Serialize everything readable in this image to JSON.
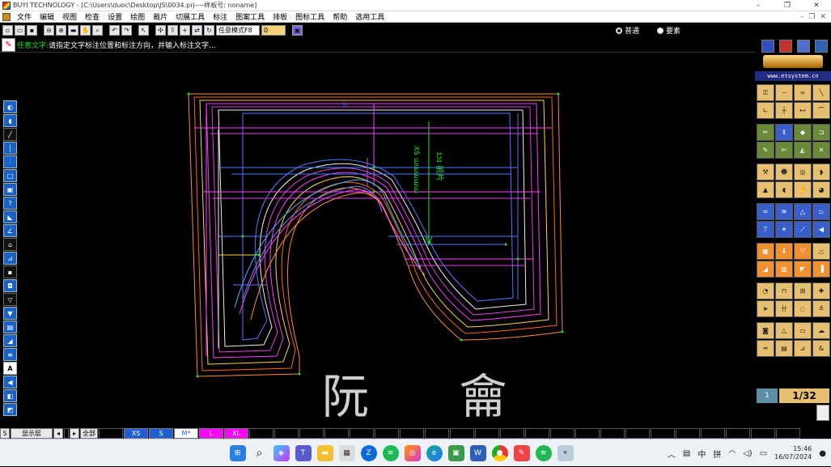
{
  "titlebar": {
    "title": "BUYI TECHNOLOGY - [C:\\Users\\duoc\\Desktop\\JS\\0034.prj----样板号: noname]",
    "controls": [
      "–",
      "❐",
      "✕"
    ]
  },
  "menubar": {
    "items": [
      "文件",
      "编辑",
      "视图",
      "检查",
      "设置",
      "绘图",
      "裁片",
      "切展工具",
      "标注",
      "图案工具",
      "排板",
      "图标工具",
      "帮助",
      "选用工具"
    ],
    "right_controls": [
      "–",
      "❐",
      "✕"
    ]
  },
  "toolbar": {
    "mode_select": "任意模式F8",
    "number_input": "0",
    "radio_normal": "普通",
    "radio_element": "要素"
  },
  "prompt": {
    "label": "任意文字:",
    "text": "请指定文字标注位置和标注方向，并输入标注文字..."
  },
  "canvas": {
    "hanzi_1": "阮",
    "hanzi_2": "龠",
    "label_text": "ɪɔɪ 前片",
    "label_size": "XS  ɯɯɯɯɯ",
    "top_mark": "h"
  },
  "right_panel": {
    "url": "www.etsystem.cn",
    "page_current": "1",
    "page_total": "1/32"
  },
  "sizebar": {
    "s_label": "S",
    "layer": "显示层",
    "all": "全部",
    "sizes": [
      "XS",
      "S",
      "M*",
      "L",
      "XL"
    ],
    "size_colors": [
      "#1f5fd6",
      "#1f5fd6",
      "#ffffff",
      "#ff00ff",
      "#ff00ff"
    ]
  },
  "taskbar": {
    "ime_1": "中",
    "ime_2": "拼",
    "time": "15:46",
    "date": "16/07/2024",
    "apps": [
      "windows-start",
      "search",
      "copilot",
      "teams",
      "file-explorer",
      "wps",
      "zalo",
      "spotify",
      "instagram",
      "edge",
      "app-green",
      "word",
      "chrome",
      "paint",
      "spotify-2",
      "app-blue"
    ]
  }
}
